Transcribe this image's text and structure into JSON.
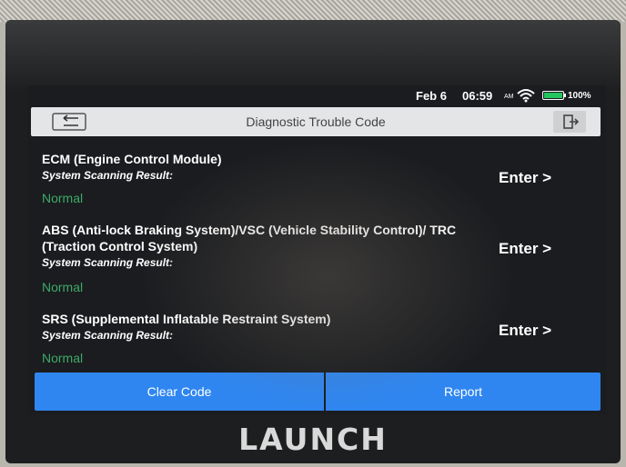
{
  "device": {
    "brand": "LAUNCH"
  },
  "status_bar": {
    "date": "Feb 6",
    "time": "06:59",
    "network": "AM",
    "battery_percent": "100%",
    "battery_level": 1.0
  },
  "header": {
    "title": "Diagnostic Trouble Code",
    "back_icon": "back-arrow-icon",
    "exit_icon": "exit-icon"
  },
  "systems": [
    {
      "name": "ECM (Engine Control Module)",
      "result_label": "System Scanning Result:",
      "result": "Normal",
      "action": "Enter >"
    },
    {
      "name": "ABS (Anti-lock Braking System)/VSC (Vehicle Stability Control)/ TRC (Traction Control System)",
      "result_label": "System Scanning Result:",
      "result": "Normal",
      "action": "Enter >"
    },
    {
      "name": "SRS (Supplemental Inflatable Restraint System)",
      "result_label": "System Scanning Result:",
      "result": "Normal",
      "action": "Enter >"
    }
  ],
  "footer": {
    "clear_label": "Clear Code",
    "report_label": "Report"
  },
  "colors": {
    "accent": "#2f86f0",
    "normal_status": "#3fa96a",
    "battery": "#22c55e"
  }
}
